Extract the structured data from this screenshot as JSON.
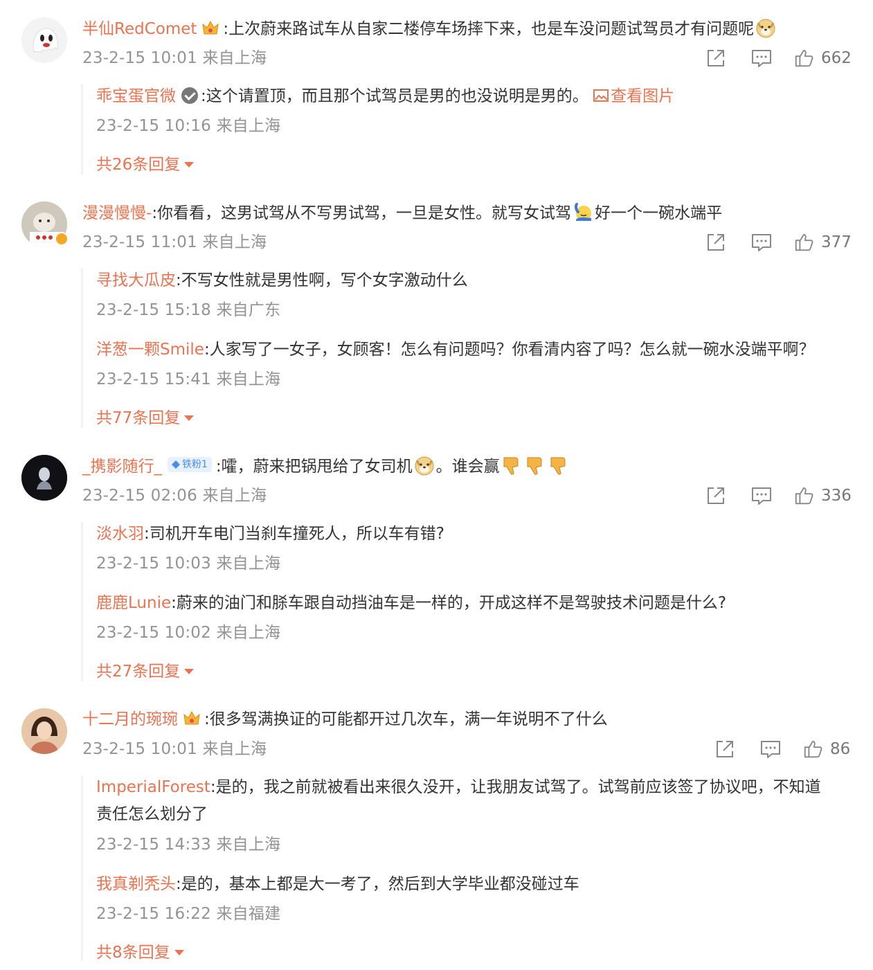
{
  "comments": [
    {
      "user": "半仙RedComet",
      "text": ":上次蔚来路试车从自家二楼停车场摔下来，也是车没问题试驾员才有问题呢",
      "meta": "23-2-15 10:01 来自上海",
      "likes": "662",
      "replies": [
        {
          "user": "乖宝蛋官微",
          "text": ":这个请置顶，而且那个试驾员是男的也没说明是男的。",
          "link": "查看图片",
          "meta": "23-2-15 10:16 来自上海"
        }
      ],
      "more": "共26条回复"
    },
    {
      "user": "漫漫慢慢-",
      "text": ":你看看，这男试驾从不写男试驾，一旦是女性。就写女试驾",
      "text_after": "好一个一碗水端平",
      "meta": "23-2-15 11:01 来自上海",
      "likes": "377",
      "replies": [
        {
          "user": "寻找大瓜皮",
          "text": ":不写女性就是男性啊，写个女字激动什么",
          "meta": "23-2-15 15:18 来自广东"
        },
        {
          "user": "洋葱一颗Smile",
          "text": ":人家写了一女子，女顾客！怎么有问题吗？你看清内容了吗？怎么就一碗水没端平啊？",
          "meta": "23-2-15 15:41 来自上海"
        }
      ],
      "more": "共77条回复"
    },
    {
      "user": "_携影随行_",
      "badge": "铁粉1",
      "text": ":嚯，蔚来把锅甩给了女司机",
      "text_after": "。谁会赢",
      "meta": "23-2-15 02:06 来自上海",
      "likes": "336",
      "replies": [
        {
          "user": "淡水羽",
          "text": ":司机开车电门当刹车撞死人，所以车有错?",
          "meta": "23-2-15 10:03 来自上海"
        },
        {
          "user": "鹿鹿Lunie",
          "text": ":蔚来的油门和脎车跟自动挡油车是一样的，开成这样不是驾驶技术问题是什么?",
          "meta": "23-2-15 10:02 来自上海"
        }
      ],
      "more": "共27条回复"
    },
    {
      "user": "十二月的琬琬",
      "text": ":很多驾满换证的可能都开过几次车，满一年说明不了什么",
      "meta": "23-2-15 10:01 来自上海",
      "likes": "86",
      "replies": [
        {
          "user": "ImperialForest",
          "text": ":是的，我之前就被看出来很久没开，让我朋友试驾了。试驾前应该签了协议吧，不知道",
          "text2": "责任怎么划分了",
          "meta": "23-2-15 14:33 来自上海"
        },
        {
          "user": "我真剃秃头",
          "text": ":是的，基本上都是大一考了，然后到大学毕业都没碰过车",
          "meta": "23-2-15 16:22 来自福建"
        }
      ],
      "more": "共8条回复"
    }
  ],
  "colors": {
    "username": "#eb7350",
    "text": "#333333",
    "meta": "#939393"
  }
}
